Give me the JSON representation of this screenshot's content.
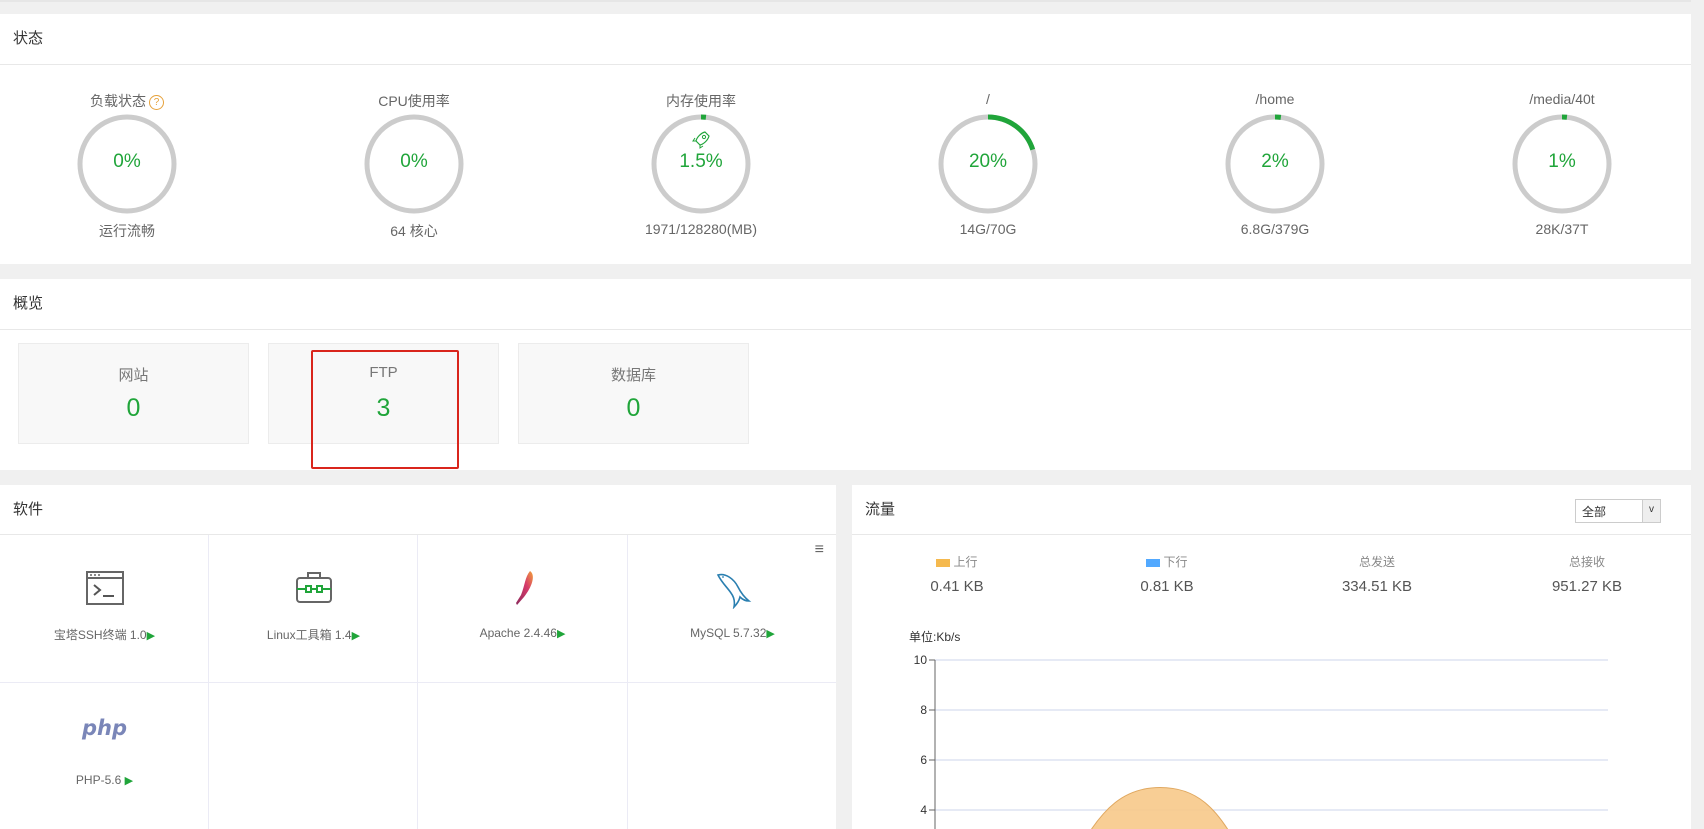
{
  "status": {
    "title": "状态",
    "gauges": [
      {
        "label": "负载状态",
        "pct": "0%",
        "sub": "运行流畅",
        "value": 0
      },
      {
        "label": "CPU使用率",
        "pct": "0%",
        "sub": "64 核心",
        "value": 0
      },
      {
        "label": "内存使用率",
        "pct": "1.5%",
        "sub": "1971/128280(MB)",
        "value": 1.5
      },
      {
        "label": "/",
        "pct": "20%",
        "sub": "14G/70G",
        "value": 20
      },
      {
        "label": "/home",
        "pct": "2%",
        "sub": "6.8G/379G",
        "value": 2
      },
      {
        "label": "/media/40t",
        "pct": "1%",
        "sub": "28K/37T",
        "value": 1
      }
    ],
    "help_glyph": "?"
  },
  "overview": {
    "title": "概览",
    "cards": [
      {
        "label": "网站",
        "value": "0"
      },
      {
        "label": "FTP",
        "value": "3"
      },
      {
        "label": "数据库",
        "value": "0"
      }
    ]
  },
  "software": {
    "title": "软件",
    "menu_glyph": "≡",
    "items": [
      {
        "name": "宝塔SSH终端 1.0",
        "icon": "terminal-icon"
      },
      {
        "name": "Linux工具箱 1.4",
        "icon": "toolbox-icon"
      },
      {
        "name": "Apache 2.4.46",
        "icon": "apache-feather-icon"
      },
      {
        "name": "MySQL 5.7.32",
        "icon": "mysql-dolphin-icon"
      },
      {
        "name": "PHP-5.6 ",
        "icon": "php-icon"
      }
    ],
    "arrow": "▶",
    "php_logo": "php"
  },
  "traffic": {
    "title": "流量",
    "select_value": "全部",
    "select_arrow": "v",
    "up_label": "上行",
    "down_label": "下行",
    "sent_label": "总发送",
    "recv_label": "总接收",
    "up_value": "0.41 KB",
    "down_value": "0.81 KB",
    "sent_value": "334.51 KB",
    "recv_value": "951.27 KB",
    "up_color": "#f5b94e",
    "down_color": "#52a9ff",
    "unit": "单位:Kb/s"
  },
  "chart_data": {
    "type": "area",
    "ylabel": "单位:Kb/s",
    "ylim": [
      0,
      10
    ],
    "yticks": [
      "10",
      "8",
      "6",
      "4"
    ],
    "series": [
      {
        "name": "上行",
        "peak": 4.9
      }
    ]
  }
}
